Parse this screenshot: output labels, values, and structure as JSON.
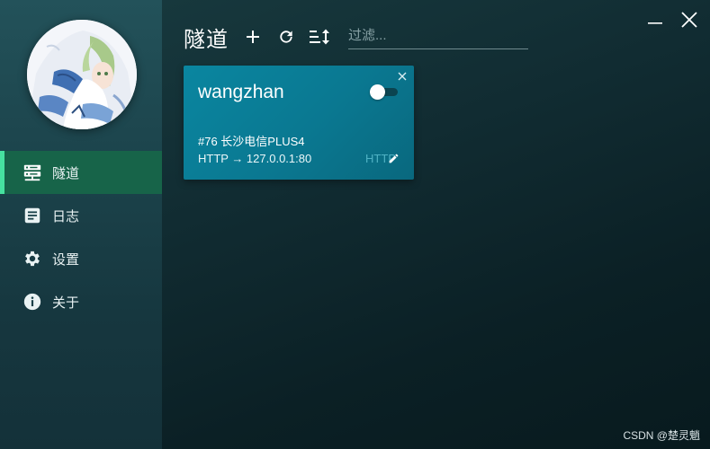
{
  "sidebar": {
    "items": [
      {
        "label": "隧道",
        "icon": "server-icon",
        "active": true
      },
      {
        "label": "日志",
        "icon": "log-icon",
        "active": false
      },
      {
        "label": "设置",
        "icon": "gear-icon",
        "active": false
      },
      {
        "label": "关于",
        "icon": "info-icon",
        "active": false
      }
    ]
  },
  "header": {
    "title": "隧道",
    "filter_placeholder": "过滤...",
    "filter_value": ""
  },
  "tunnel": {
    "name": "wangzhan",
    "enabled": false,
    "node": "#76 长沙电信PLUS4",
    "route": "HTTP → 127.0.0.1:80",
    "protocol_tag": "HTTP"
  },
  "watermark": "CSDN @楚灵魈",
  "colors": {
    "active_nav": "#176449",
    "active_indicator": "#46e2a0",
    "card": "#0a7f98"
  }
}
